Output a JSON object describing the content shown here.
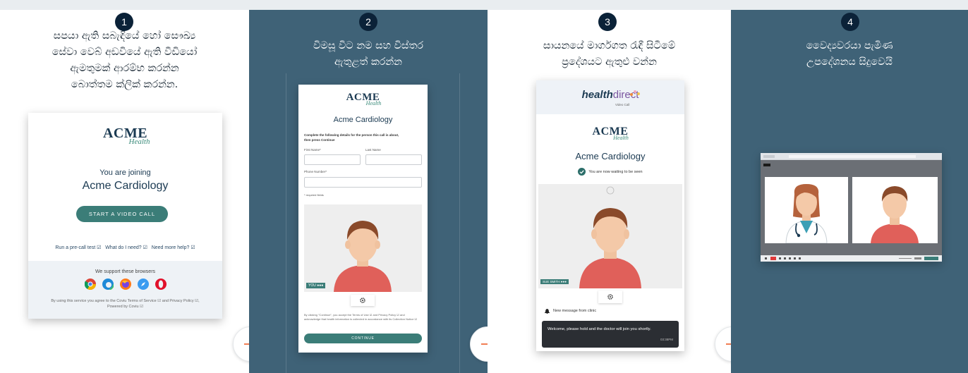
{
  "steps": [
    {
      "number": "1",
      "caption_lines": [
        "සපයා ඇති සබැඳියේ හෝ සෞඛ්‍ය",
        "සේවා වෙබ් අඩවියේ ඇති වීඩියෝ",
        "ඇමතුමක් ආරම්භ කරන්න",
        "බොත්තම ක්ලික් කරන්න."
      ]
    },
    {
      "number": "2",
      "caption_lines": [
        "විමසූ විට නම සහ විස්තර",
        "ඇතුළත් කරන්න"
      ]
    },
    {
      "number": "3",
      "caption_lines": [
        "සායනයේ මාර්ගගත රැඳී සිටීමේ",
        "ප්‍රදේශයට ඇතුළු වන්න"
      ]
    },
    {
      "number": "4",
      "caption_lines": [
        "වෛද්‍යවරයා පැමිණ",
        "උපදේශනය සිදුවෙයි"
      ]
    }
  ],
  "card1": {
    "logo": "ACME",
    "logo_sub": "Health",
    "joining_text": "You are joining",
    "clinic_name": "Acme Cardiology",
    "start_button": "START A VIDEO CALL",
    "links": [
      "Run a pre-call test ☑",
      "What do I need? ☑",
      "Need more help? ☑"
    ],
    "browsers_heading": "We support these browsers",
    "footer_line1": "By using this service you agree to the Coviu Terms of Service ☑ and Privacy Policy ☑,",
    "footer_line2": "Powered by Coviu ☑"
  },
  "card2": {
    "logo": "ACME",
    "logo_sub": "Health",
    "clinic_name": "Acme Cardiology",
    "instructions_line1": "Complete the following details for the person this call is about,",
    "instructions_line2": "then press Continue",
    "first_name_label": "First Name*",
    "last_name_label": "Last Name",
    "phone_label": "Phone Number*",
    "required_note": "* required fields",
    "video_tag": "YOU ●●●",
    "terms_text": "By clicking \"Continue\", you accept the Terms of Use ☑ and Privacy Policy ☑ and acknowledge that health information is collected in accordance with its Collection Notice ☑",
    "continue_button": "CONTINUE"
  },
  "card3": {
    "brand_health": "health",
    "brand_direct": "direct",
    "brand_sub": "Video Call",
    "logo": "ACME",
    "logo_sub": "Health",
    "clinic_name": "Acme Cardiology",
    "waiting_text": "You are now waiting to be seen",
    "video_tag": "SUE SMITH ●●●",
    "message_heading": "New message from clinic",
    "message_text": "Welcome, please hold and the doctor will join you shortly.",
    "message_time": "03:38PM"
  },
  "colors": {
    "panel_dark": "#3f6277",
    "step_badge": "#0b2238",
    "accent_teal": "#3b7d78",
    "arrow_orange": "#ef6c3c",
    "person_shirt": "#e0605a",
    "person_hair": "#8a4a2a",
    "person_skin": "#f4c9a8"
  }
}
